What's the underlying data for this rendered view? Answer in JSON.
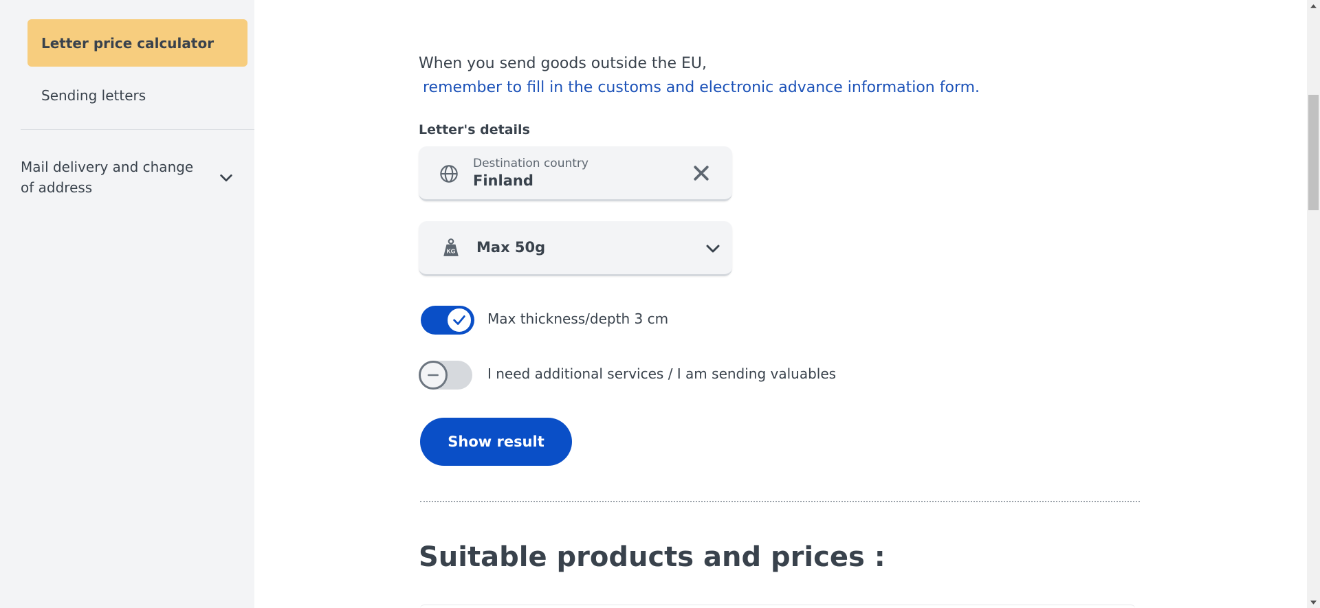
{
  "sidebar": {
    "active_item": "Letter price calculator",
    "items": [
      {
        "label": "Sending letters"
      }
    ],
    "group": {
      "label": "Mail delivery and change of address"
    }
  },
  "notice": {
    "text": "When you send goods outside the EU,",
    "link_text": "remember to fill in the customs and electronic advance information form."
  },
  "form": {
    "section_label": "Letter's details",
    "country": {
      "label": "Destination country",
      "value": "Finland",
      "icon": "globe-icon"
    },
    "weight": {
      "value": "Max 50g",
      "icon": "weight-kg-icon"
    },
    "toggles": [
      {
        "label": "Max thickness/depth 3 cm",
        "checked": true
      },
      {
        "label": "I need additional services / I am sending valuables",
        "checked": false
      }
    ],
    "submit_label": "Show result"
  },
  "results": {
    "heading": "Suitable products and prices :"
  },
  "colors": {
    "sidebar_bg": "#f3f4f6",
    "active_item_bg": "#f7cd7e",
    "primary": "#0a4fc7",
    "link": "#1c52b8",
    "text": "#39424c"
  }
}
